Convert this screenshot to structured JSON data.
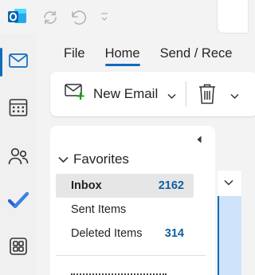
{
  "app": {
    "brand_color": "#0f6cbd"
  },
  "title_bar": {
    "icons": [
      "outlook-logo-icon",
      "sync-icon",
      "undo-icon",
      "customize-dropdown-icon"
    ]
  },
  "rail": {
    "items": [
      {
        "name": "mail",
        "icon": "mail-icon",
        "active": true
      },
      {
        "name": "calendar",
        "icon": "calendar-icon",
        "active": false
      },
      {
        "name": "people",
        "icon": "people-icon",
        "active": false
      },
      {
        "name": "todo",
        "icon": "todo-check-icon",
        "active": false
      },
      {
        "name": "apps",
        "icon": "apps-icon",
        "active": false
      }
    ]
  },
  "ribbon": {
    "tabs": [
      {
        "label": "File",
        "active": false
      },
      {
        "label": "Home",
        "active": true
      },
      {
        "label": "Send / Rece",
        "active": false
      }
    ],
    "new_email_label": "New Email",
    "delete_icon": "trash-icon"
  },
  "folders": {
    "favorites_label": "Favorites",
    "items": [
      {
        "label": "Inbox",
        "count": "2162",
        "selected": true
      },
      {
        "label": "Sent Items",
        "count": "",
        "selected": false
      },
      {
        "label": "Deleted Items",
        "count": "314",
        "selected": false
      }
    ]
  }
}
